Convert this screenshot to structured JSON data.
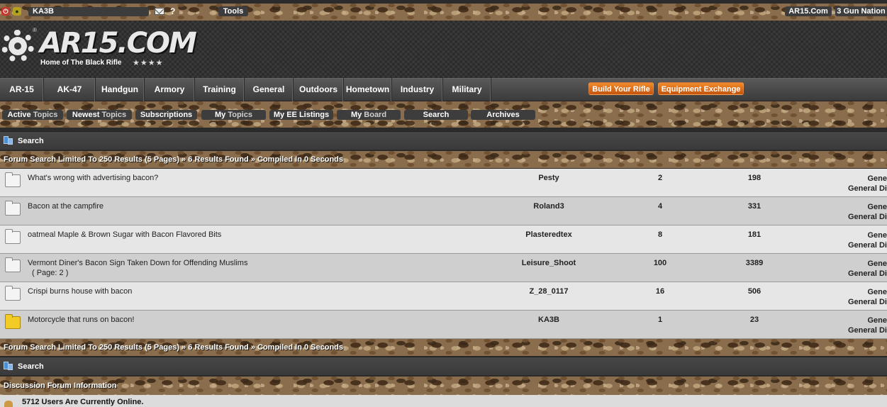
{
  "topbar": {
    "username": "KA3B",
    "help": "?",
    "tools": "Tools",
    "links": [
      "AR15.Com",
      "3 Gun Nation"
    ]
  },
  "header": {
    "logo": "AR15.COM",
    "registered": "®",
    "tagline": "Home of The Black Rifle",
    "stars": "★★★★"
  },
  "mainnav": {
    "items": [
      "AR-15",
      "AK-47",
      "Handgun",
      "Armory",
      "Training",
      "General",
      "Outdoors",
      "Hometown",
      "Industry",
      "Military"
    ],
    "build_your_rifle": "Build Your Rifle",
    "equipment_exchange": "Equipment Exchange"
  },
  "subnav": {
    "active": "Active",
    "topics": "Topics",
    "newest": "Newest",
    "subscriptions": "Subscriptions",
    "my": "My",
    "my_topics": "Topics",
    "my_ee_listings": "My EE Listings",
    "board": "Board",
    "search": "Search",
    "archives": "Archives"
  },
  "search_header": "Search",
  "results_summary": "Forum Search Limited To 250 Results (5 Pages) » 6 Results Found » Compiled In 0 Seconds",
  "results": [
    {
      "title": "What's wrong with advertising bacon?",
      "pages": "",
      "author": "Pesty",
      "replies": "2",
      "views": "198",
      "forum1": "Gene",
      "forum2": "General Di",
      "new": false
    },
    {
      "title": "Bacon at the campfire",
      "pages": "",
      "author": "Roland3",
      "replies": "4",
      "views": "331",
      "forum1": "Gene",
      "forum2": "General Di",
      "new": false
    },
    {
      "title": "oatmeal Maple & Brown Sugar with Bacon Flavored Bits",
      "pages": "",
      "author": "Plasteredtex",
      "replies": "8",
      "views": "181",
      "forum1": "Gene",
      "forum2": "General Di",
      "new": false
    },
    {
      "title": "Vermont Diner's Bacon Sign Taken Down for Offending Muslims",
      "pages": "( Page:  2  )",
      "author": "Leisure_Shoot",
      "replies": "100",
      "views": "3389",
      "forum1": "Gene",
      "forum2": "General Di",
      "new": false
    },
    {
      "title": "Crispi burns house with bacon",
      "pages": "",
      "author": "Z_28_0117",
      "replies": "16",
      "views": "506",
      "forum1": "Gene",
      "forum2": "General Di",
      "new": false
    },
    {
      "title": "Motorcycle that runs on bacon!",
      "pages": "",
      "author": "KA3B",
      "replies": "1",
      "views": "23",
      "forum1": "Gene",
      "forum2": "General Di",
      "new": true
    }
  ],
  "search_footer": "Search",
  "info_header": "Discussion Forum Information",
  "online_text": "5712 Users Are Currently Online."
}
